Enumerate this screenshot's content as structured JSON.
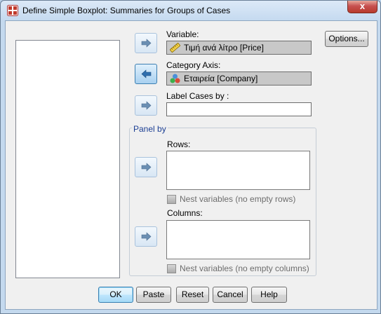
{
  "window": {
    "title": "Define Simple Boxplot: Summaries for Groups of Cases",
    "close_glyph": "x"
  },
  "fields": {
    "variable": {
      "label": "Variable:",
      "value": "Τιμή ανά λίτρο [Price]",
      "icon": "ruler-scale-icon"
    },
    "category_axis": {
      "label": "Category Axis:",
      "value": "Εταιρεία [Company]",
      "icon": "nominal-variable-icon"
    },
    "label_cases": {
      "label": "Label Cases by :",
      "value": ""
    }
  },
  "panel": {
    "legend": "Panel by",
    "rows": {
      "label": "Rows:",
      "nest_label": "Nest variables (no empty rows)",
      "nest_checked": false
    },
    "columns": {
      "label": "Columns:",
      "nest_label": "Nest variables (no empty columns)",
      "nest_checked": false
    }
  },
  "buttons": {
    "options": "Options...",
    "ok": "OK",
    "paste": "Paste",
    "reset": "Reset",
    "cancel": "Cancel",
    "help": "Help"
  },
  "colors": {
    "selected_field": "#c8c8c8",
    "group_legend": "#1c3f94",
    "disabled_text": "#6d6d6d"
  }
}
